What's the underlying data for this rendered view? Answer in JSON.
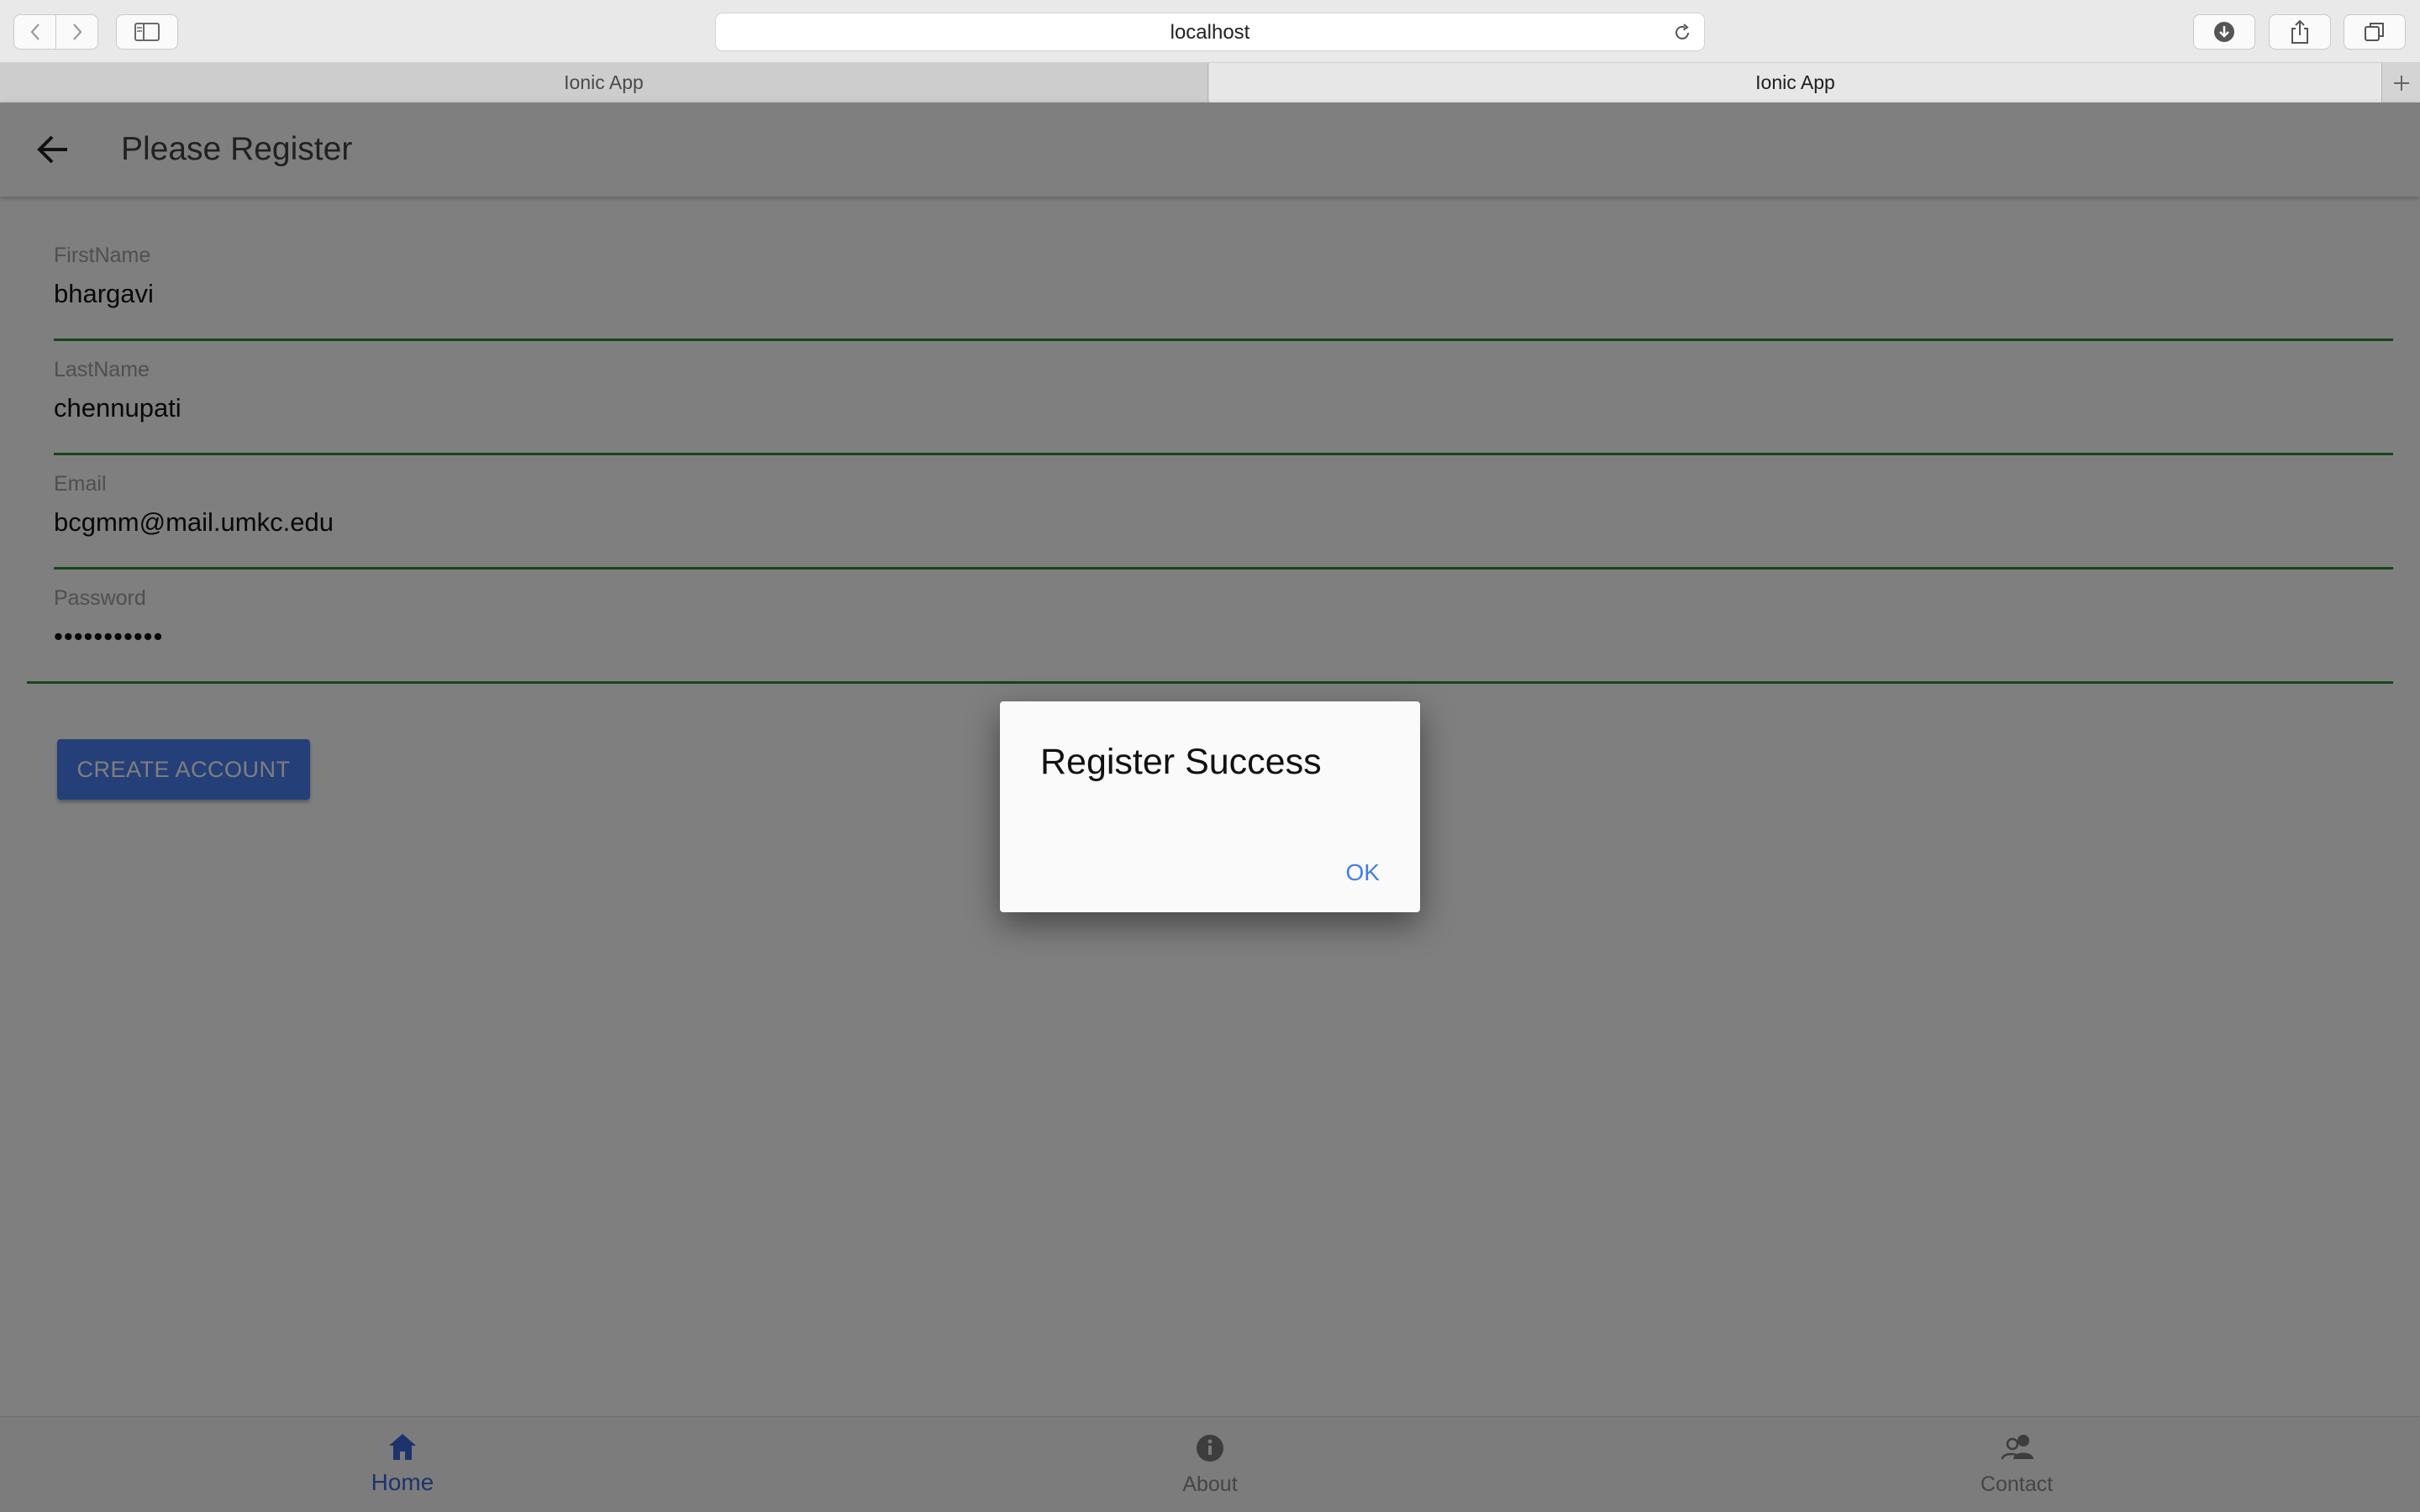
{
  "browser": {
    "url": "localhost",
    "tabs": [
      {
        "label": "Ionic App",
        "active": false
      },
      {
        "label": "Ionic App",
        "active": true
      }
    ]
  },
  "app": {
    "header": {
      "title": "Please Register"
    },
    "form": {
      "firstname": {
        "label": "FirstName",
        "value": "bhargavi"
      },
      "lastname": {
        "label": "LastName",
        "value": "chennupati"
      },
      "email": {
        "label": "Email",
        "value": "bcgmm@mail.umkc.edu"
      },
      "password": {
        "label": "Password",
        "value": "•••••••••••"
      },
      "create_button": "CREATE ACCOUNT"
    },
    "tabs": [
      {
        "label": "Home",
        "icon": "home-icon",
        "active": true
      },
      {
        "label": "About",
        "icon": "info-icon",
        "active": false
      },
      {
        "label": "Contact",
        "icon": "contacts-icon",
        "active": false
      }
    ]
  },
  "dialog": {
    "title": "Register Success",
    "ok_label": "OK"
  },
  "colors": {
    "accent": "#3f7fe9",
    "valid_underline": "#2e8b3a",
    "button": "#4a7ef0"
  }
}
